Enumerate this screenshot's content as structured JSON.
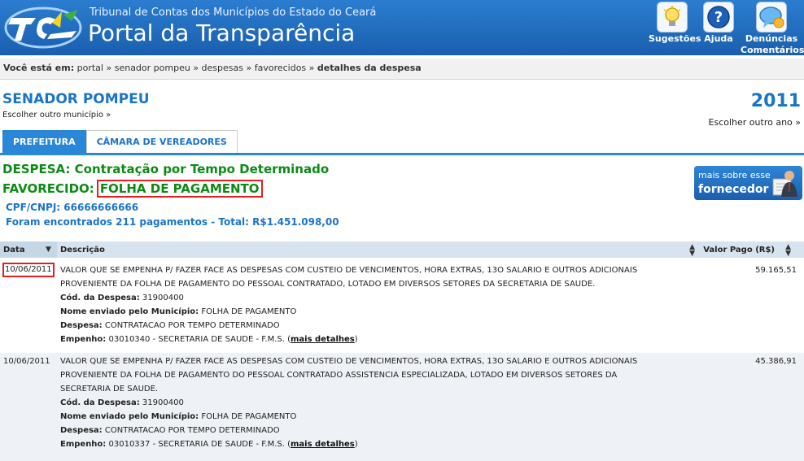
{
  "header": {
    "org_name": "Tribunal de Contas dos Municípios do Estado do Ceará",
    "portal_title": "Portal da Transparência",
    "buttons": [
      {
        "label": "Sugestões",
        "icon": "lightbulb-icon"
      },
      {
        "label": "Ajuda",
        "icon": "help-icon"
      },
      {
        "label_line1": "Denúncias",
        "label_line2": "Comentários",
        "icon": "comment-bubble-icon"
      }
    ]
  },
  "breadcrumb": {
    "prefix": "Você está em:",
    "items": [
      "portal",
      "senador pompeu",
      "despesas",
      "favorecidos"
    ],
    "current": "detalhes da despesa",
    "separator": "»"
  },
  "city": {
    "name": "SENADOR POMPEU",
    "change": "Escolher outro município »"
  },
  "year": {
    "value": "2011",
    "change": "Escolher outro ano »"
  },
  "tabs": [
    {
      "label": "PREFEITURA",
      "active": true
    },
    {
      "label": "CÂMARA DE VEREADORES",
      "active": false
    }
  ],
  "expense": {
    "despesa_label": "DESPESA:",
    "despesa_value": "Contratação por Tempo Determinado",
    "favorecido_label": "FAVORECIDO:",
    "favorecido_value": "FOLHA DE PAGAMENTO",
    "cpf": "CPF/CNPJ: 66666666666",
    "found": "Foram encontrados 211 pagamentos - Total: R$1.451.098,00"
  },
  "more_button": {
    "line1": "mais sobre esse",
    "line2": "fornecedor"
  },
  "table": {
    "headers": {
      "date": "Data",
      "desc": "Descrição",
      "value": "Valor Pago (R$)"
    },
    "rows": [
      {
        "date": "10/06/2011",
        "desc_line1": "VALOR QUE SE EMPENHA P/ FAZER FACE AS DESPESAS COM CUSTEIO DE VENCIMENTOS, HORA EXTRAS, 13O SALARIO E OUTROS ADICIONAIS",
        "desc_line2": "PROVENIENTE DA FOLHA DE PAGAMENTO DO PESSOAL CONTRATADO, LOTADO EM DIVERSOS SETORES DA SECRETARIA DE SAUDE.",
        "desc_line3": "",
        "cod_label": "Cód. da Despesa:",
        "cod": "31900400",
        "nome_label": "Nome enviado pelo Município:",
        "nome": "FOLHA DE PAGAMENTO",
        "despesa_label": "Despesa:",
        "despesa": "CONTRATACAO POR TEMPO DETERMINADO",
        "empenho_label": "Empenho:",
        "empenho": "03010340 - SECRETARIA DE SAUDE - F.M.S. (",
        "link": "mais detalhes",
        "close": ")",
        "value": "59.165,51"
      },
      {
        "date": "10/06/2011",
        "desc_line1": "VALOR QUE SE EMPENHA P/ FAZER FACE AS DESPESAS COM CUSTEIO DE VENCIMENTOS, HORA EXTRAS, 13O SALARIO E OUTROS ADICIONAIS",
        "desc_line2": "PROVENIENTE DA FOLHA DE PAGAMENTO DO PESSOAL CONTRATADO ASSISTENCIA ESPECIALIZADA, LOTADO EM DIVERSOS SETORES DA",
        "desc_line3": "SECRETARIA DE SAUDE.",
        "cod_label": "Cód. da Despesa:",
        "cod": "31900400",
        "nome_label": "Nome enviado pelo Município:",
        "nome": "FOLHA DE PAGAMENTO",
        "despesa_label": "Despesa:",
        "despesa": "CONTRATACAO POR TEMPO DETERMINADO",
        "empenho_label": "Empenho:",
        "empenho": "03010337 - SECRETARIA DE SAUDE - F.M.S. (",
        "link": "mais detalhes",
        "close": ")",
        "value": "45.386,91"
      }
    ]
  },
  "colors": {
    "header_blue": "#1f6cc0",
    "link_blue": "#1b74c6",
    "green": "#0d8a14",
    "highlight_red": "#e02020"
  }
}
